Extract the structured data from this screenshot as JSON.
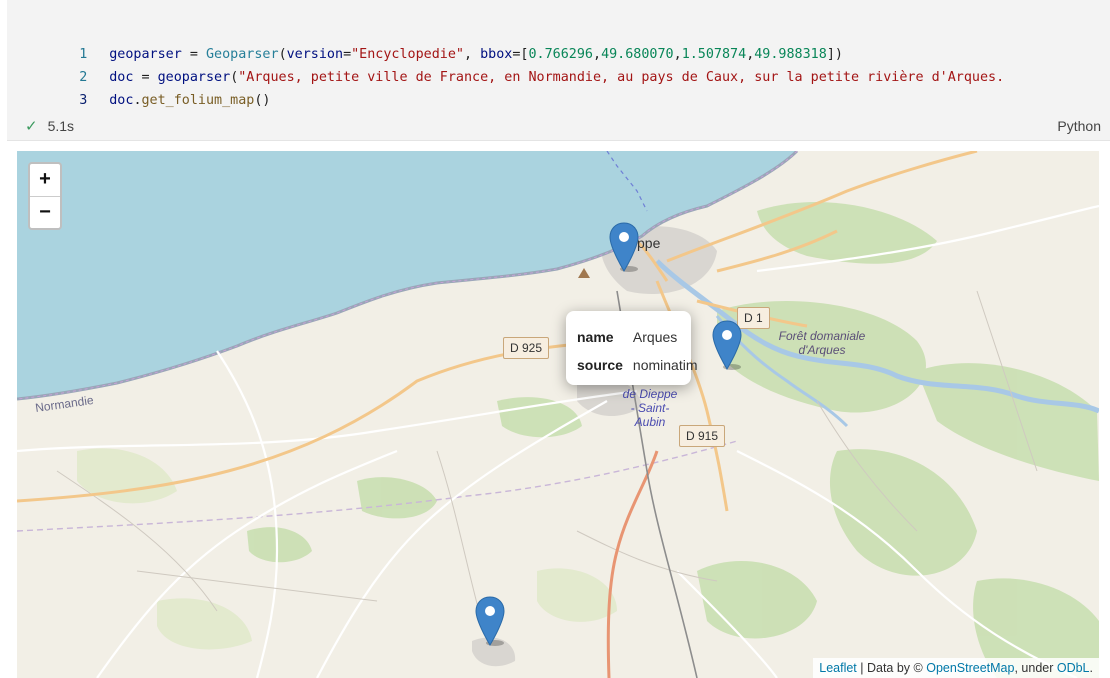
{
  "cell": {
    "lines": [
      {
        "number": "1"
      },
      {
        "number": "2"
      },
      {
        "number": "3"
      }
    ],
    "code": {
      "l1": {
        "var": "geoparser",
        "eq": " = ",
        "cls": "Geoparser",
        "open": "(",
        "kw1": "version",
        "eq1": "=",
        "s1": "\"Encyclopedie\"",
        "c1": ", ",
        "kw2": "bbox",
        "eq2": "=[",
        "n1": "0.766296",
        "c2": ",",
        "n2": "49.680070",
        "c3": ",",
        "n3": "1.507874",
        "c4": ",",
        "n4": "49.988318",
        "close": "])"
      },
      "l2": {
        "var": "doc",
        "eq": " = ",
        "fn": "geoparser",
        "open": "(",
        "s1": "\"Arques, petite ville de France, en Normandie, au pays de Caux, sur la petite rivière d'Arques."
      },
      "l3": {
        "var": "doc",
        "dot": ".",
        "fn": "get_folium_map",
        "paren": "()"
      }
    },
    "status": {
      "check_icon": "✓",
      "duration": "5.1s"
    },
    "language": "Python"
  },
  "map": {
    "zoom_in": "+",
    "zoom_out": "−",
    "labels": {
      "normandie": "Normandie",
      "dieppe": "ppe",
      "foret_line1": "Forêt domaniale",
      "foret_line2": "d'Arques",
      "dieppe_aubin_1": "de Dieppe",
      "dieppe_aubin_2": "- Saint-",
      "dieppe_aubin_3": "Aubin"
    },
    "roads": {
      "d925": "D 925",
      "d1": "D 1",
      "d915": "D 915"
    },
    "popup": {
      "rows": [
        {
          "key": "name",
          "value": "Arques"
        },
        {
          "key": "source",
          "value": "nominatim"
        }
      ]
    },
    "attribution": {
      "leaflet": "Leaflet",
      "sep1": " | Data by © ",
      "osm": "OpenStreetMap",
      "sep2": ", under ",
      "odbl": "ODbL",
      "end": "."
    },
    "colors": {
      "marker": "#3f84c9",
      "sea": "#aad3df",
      "land": "#f2efe6",
      "forest": "#c9dfb1"
    }
  }
}
